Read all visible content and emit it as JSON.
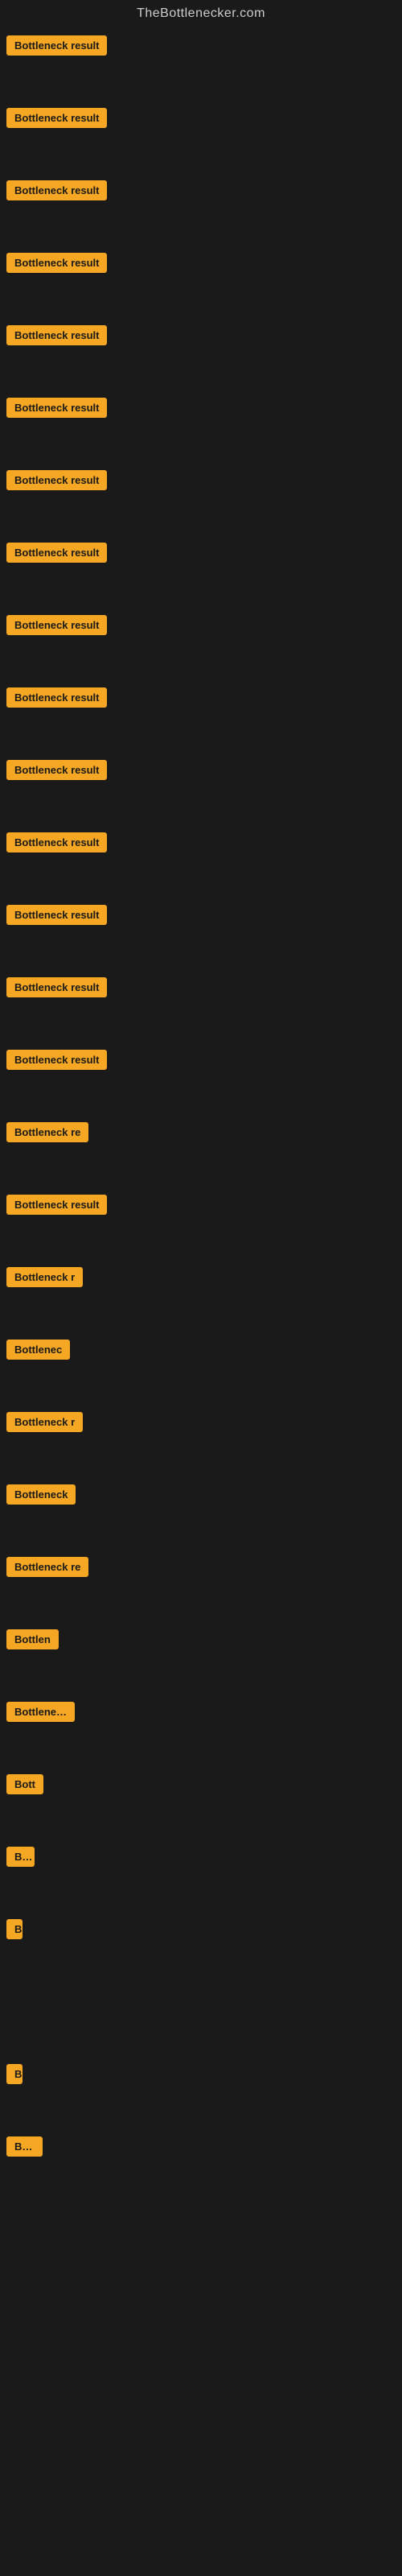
{
  "site": {
    "title": "TheBottlenecker.com"
  },
  "items": [
    {
      "id": 1,
      "label": "Bottleneck result",
      "class": "item-1"
    },
    {
      "id": 2,
      "label": "Bottleneck result",
      "class": "item-2"
    },
    {
      "id": 3,
      "label": "Bottleneck result",
      "class": "item-3"
    },
    {
      "id": 4,
      "label": "Bottleneck result",
      "class": "item-4"
    },
    {
      "id": 5,
      "label": "Bottleneck result",
      "class": "item-5"
    },
    {
      "id": 6,
      "label": "Bottleneck result",
      "class": "item-6"
    },
    {
      "id": 7,
      "label": "Bottleneck result",
      "class": "item-7"
    },
    {
      "id": 8,
      "label": "Bottleneck result",
      "class": "item-8"
    },
    {
      "id": 9,
      "label": "Bottleneck result",
      "class": "item-9"
    },
    {
      "id": 10,
      "label": "Bottleneck result",
      "class": "item-10"
    },
    {
      "id": 11,
      "label": "Bottleneck result",
      "class": "item-11"
    },
    {
      "id": 12,
      "label": "Bottleneck result",
      "class": "item-12"
    },
    {
      "id": 13,
      "label": "Bottleneck result",
      "class": "item-13"
    },
    {
      "id": 14,
      "label": "Bottleneck result",
      "class": "item-14"
    },
    {
      "id": 15,
      "label": "Bottleneck result",
      "class": "item-15"
    },
    {
      "id": 16,
      "label": "Bottleneck re",
      "class": "item-16"
    },
    {
      "id": 17,
      "label": "Bottleneck result",
      "class": "item-17"
    },
    {
      "id": 18,
      "label": "Bottleneck r",
      "class": "item-18"
    },
    {
      "id": 19,
      "label": "Bottlenec",
      "class": "item-19"
    },
    {
      "id": 20,
      "label": "Bottleneck r",
      "class": "item-20"
    },
    {
      "id": 21,
      "label": "Bottleneck",
      "class": "item-21"
    },
    {
      "id": 22,
      "label": "Bottleneck re",
      "class": "item-22"
    },
    {
      "id": 23,
      "label": "Bottlen",
      "class": "item-23"
    },
    {
      "id": 24,
      "label": "Bottleneck",
      "class": "item-24"
    },
    {
      "id": 25,
      "label": "Bott",
      "class": "item-25"
    },
    {
      "id": 26,
      "label": "Bo",
      "class": "item-26"
    },
    {
      "id": 27,
      "label": "B",
      "class": "item-27"
    },
    {
      "id": 28,
      "label": "",
      "class": "item-28"
    },
    {
      "id": 29,
      "label": "B",
      "class": "item-29"
    },
    {
      "id": 30,
      "label": "Bott",
      "class": "item-30"
    }
  ],
  "colors": {
    "badge_bg": "#f5a623",
    "badge_text": "#1a1a1a",
    "background": "#1a1a1a",
    "title_text": "#cccccc"
  }
}
